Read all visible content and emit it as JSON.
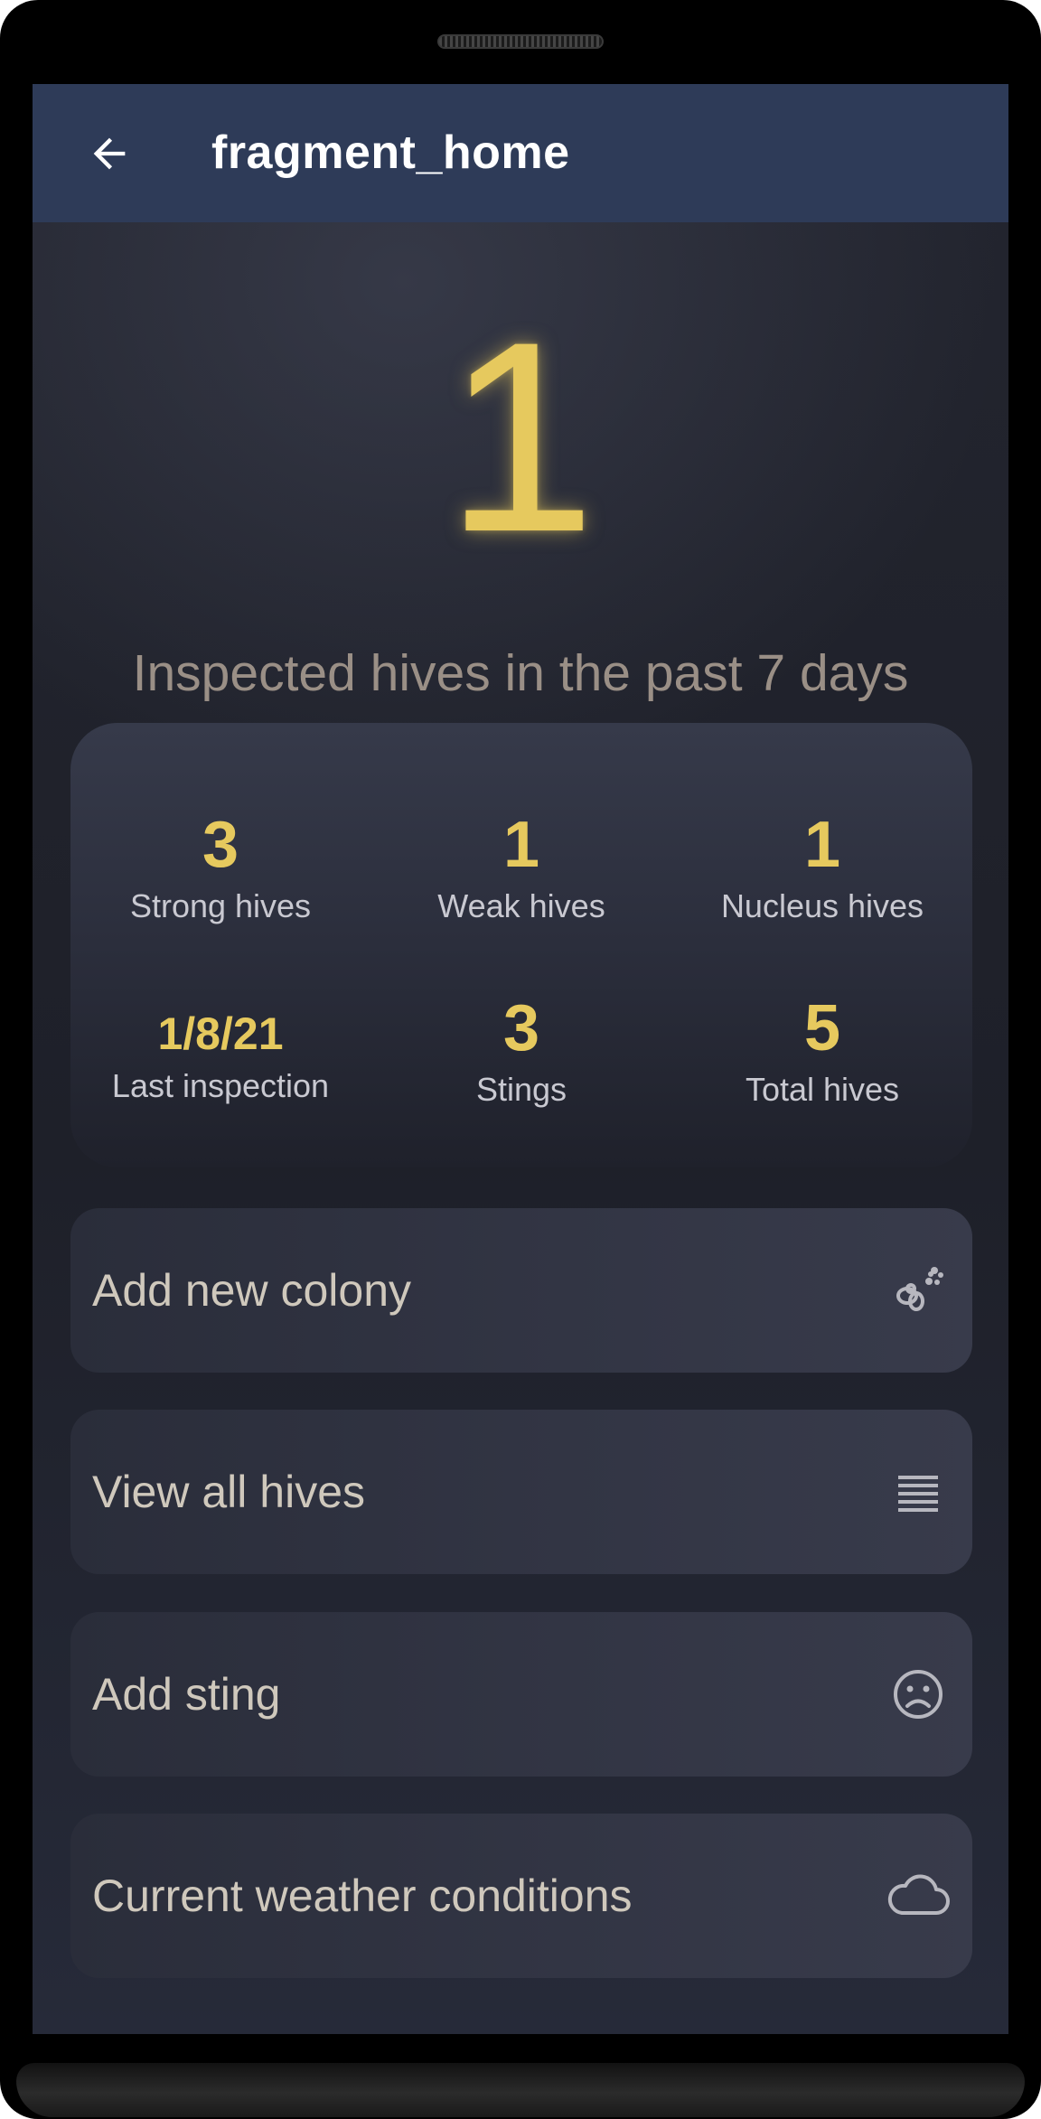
{
  "app_bar": {
    "back_icon": "arrow-back-icon",
    "title": "fragment_home"
  },
  "summary": {
    "inspected_count": "1",
    "inspected_caption": "Inspected hives in the past 7 days"
  },
  "stats": [
    {
      "value": "3",
      "label": "Strong hives"
    },
    {
      "value": "1",
      "label": "Weak hives"
    },
    {
      "value": "1",
      "label": "Nucleus hives"
    },
    {
      "value": "1/8/21",
      "label": "Last inspection"
    },
    {
      "value": "3",
      "label": "Stings"
    },
    {
      "value": "5",
      "label": "Total hives"
    }
  ],
  "actions": [
    {
      "label": "Add new colony",
      "icon": "bee-colony-icon"
    },
    {
      "label": "View all hives",
      "icon": "list-icon"
    },
    {
      "label": "Add sting",
      "icon": "sad-face-icon"
    },
    {
      "label": "Current weather conditions",
      "icon": "cloud-icon"
    }
  ],
  "colors": {
    "accent_yellow": "#e6c95e",
    "app_bar": "#2e3b58",
    "background": "#1e2029",
    "card": "#323544",
    "caption": "#9a8f86",
    "stat_label": "#c9c9d1",
    "action_label": "#cfc8bc"
  }
}
